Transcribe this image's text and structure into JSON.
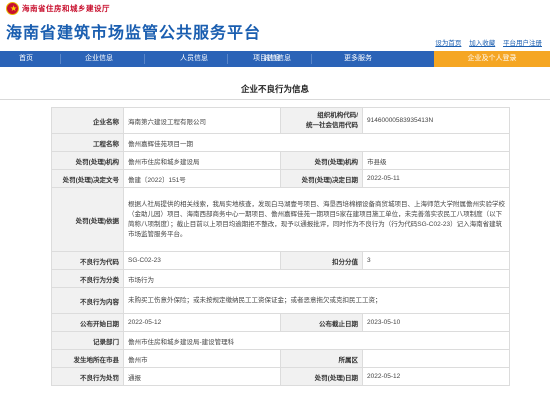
{
  "header": {
    "dept_name": "海南省住房和城乡建设厅",
    "site_title": "海南省建筑市场监管公共服务平台",
    "links": [
      "设为首页",
      "加入收藏",
      "平台用户注册"
    ]
  },
  "nav": {
    "items": [
      "首页",
      "企业信息",
      "人员信息",
      "项目信息",
      "诚信信息",
      "更多服务"
    ],
    "login": "企业及个人登录"
  },
  "page": {
    "title": "企业不良行为信息"
  },
  "record": {
    "company_label": "企业名称",
    "company": "海南第六建设工程有限公司",
    "org_code_label_1": "组织机构代码/",
    "org_code_label_2": "统一社会信用代码",
    "org_code": "91460000583935413N",
    "project_label": "工程名称",
    "project": "儋州嘉辉佳苑项目一期",
    "handler_label": "处罚(处理)机构",
    "handler": "儋州市住房和城乡建设局",
    "handler_level_label": "处罚(处理)机构",
    "handler_level": "市县级",
    "doc_no_label": "处罚(处理)决定文号",
    "doc_no": "儋建〔2022〕151号",
    "decision_date_label": "处罚(处理)决定日期",
    "decision_date": "2022-05-11",
    "basis_label": "处罚(处理)依据",
    "basis": "根据人社局提供的相关线索，我局实地核查，发现白马湖壹号项目、海垦西培棉棚设备商贸城项目、上海师范大学附属儋州实验学校（金助儿园）项目、海南西部商务中心一期项目、儋州嘉辉佳苑一期项目5家在建项目施工单位，未完善落实农民工八项制度（以下简称八项制度）；截止目前以上项目均逾期拒不整改，现予以通报批评，同时作为不良行为（行为代码SG-C02-23）记入海南省建筑市场监管服务平台。",
    "behavior_code_label": "不良行为代码",
    "behavior_code": "SG-C02-23",
    "deduct_label": "扣分分值",
    "deduct": "3",
    "category_label": "不良行为分类",
    "category": "市场行为",
    "content_label": "不良行为内容",
    "content": "未购买工伤意外保险；或未按规定缴纳民工工资保证金；或者恶意拖欠或克扣民工工资；",
    "publish_date_label": "公布开始日期",
    "publish_date": "2022-05-12",
    "publish_end_label": "公布截止日期",
    "publish_end": "2023-05-10",
    "recorder_label": "记录部门",
    "recorder": "儋州市住房和城乡建设局-建设管理科",
    "location_label": "发生地所在市县",
    "location": "儋州市",
    "district_label": "所属区",
    "district": "",
    "punish_type_label": "不良行为处罚",
    "punish_type": "通报",
    "punish_date_label": "处罚(处理)日期",
    "punish_date": "2022-05-12"
  }
}
